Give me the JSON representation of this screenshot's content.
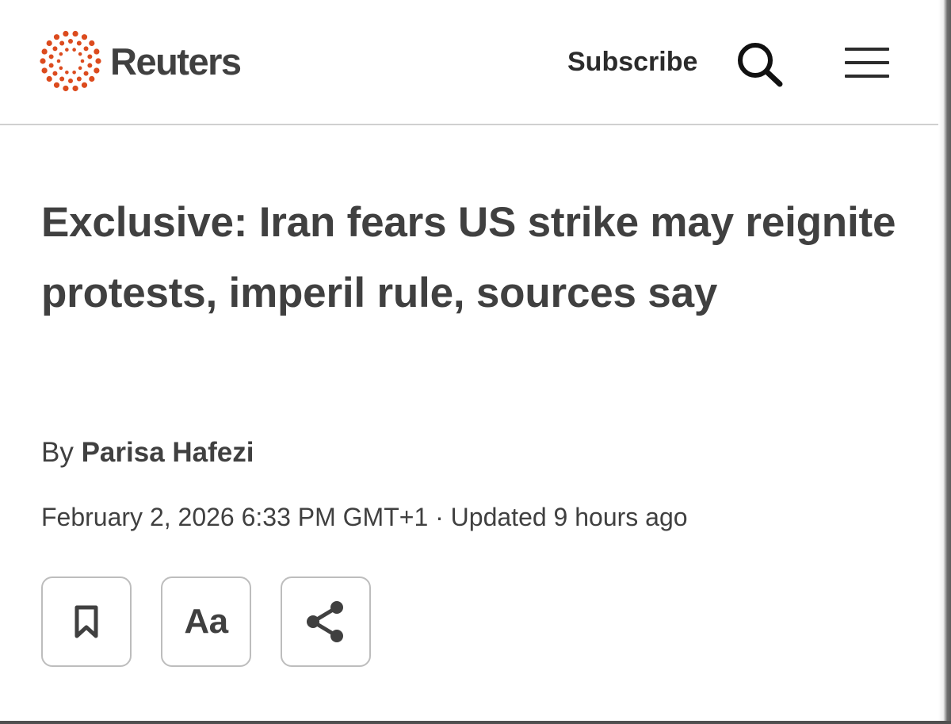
{
  "header": {
    "brand_name": "Reuters",
    "subscribe_label": "Subscribe",
    "icons": [
      "reuters-logo-icon",
      "search-icon",
      "hamburger-menu-icon"
    ],
    "brand_color": "#dc4b1e"
  },
  "article": {
    "headline": "Exclusive: Iran fears US strike may reignite protests, imperil rule, sources say",
    "byline_prefix": "By ",
    "author": "Parisa Hafezi",
    "dateline": "February 2, 2026 6:33 PM GMT+1 · Updated 9 hours ago"
  },
  "actions": {
    "bookmark_icon": "bookmark-icon",
    "font_size_label": "Aa",
    "share_icon": "share-icon"
  }
}
